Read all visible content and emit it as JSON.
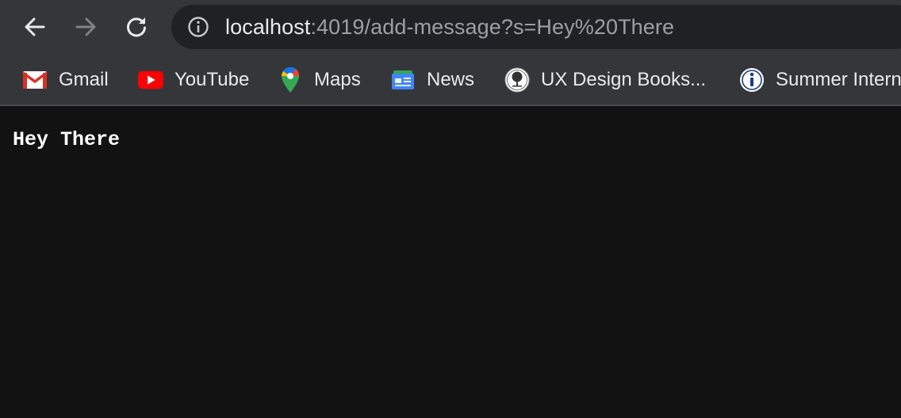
{
  "nav": {
    "back_icon": "arrow-left-icon",
    "forward_icon": "arrow-right-icon",
    "reload_icon": "reload-icon"
  },
  "address_bar": {
    "info_icon": "info-icon",
    "host": "localhost",
    "path": ":4019/add-message?s=Hey%20There"
  },
  "bookmarks": [
    {
      "label": "Gmail",
      "icon": "gmail-icon"
    },
    {
      "label": "YouTube",
      "icon": "youtube-icon"
    },
    {
      "label": "Maps",
      "icon": "maps-icon"
    },
    {
      "label": "News",
      "icon": "news-icon"
    },
    {
      "label": "UX Design Books...",
      "icon": "tree-seal-icon"
    },
    {
      "label": "Summer Intern",
      "icon": "info-circle-icon"
    }
  ],
  "page": {
    "message": "Hey There"
  },
  "colors": {
    "toolbar": "#35363a",
    "omnibox": "#202124",
    "page_background": "#121212",
    "text": "#e8eaed"
  }
}
